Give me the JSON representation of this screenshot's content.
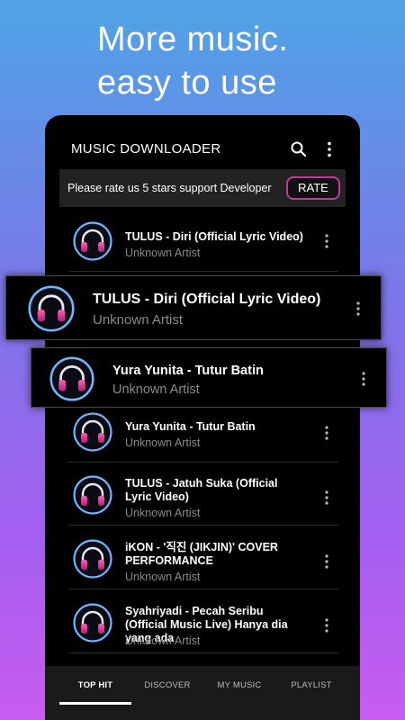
{
  "promo": {
    "line1": "More music.",
    "line2": "easy to use"
  },
  "app": {
    "title": "MUSIC DOWNLOADER",
    "search_icon": "search-icon",
    "menu_icon": "more-vert-icon"
  },
  "rate_banner": {
    "text": "Please rate us 5 stars support Developer",
    "button_label": "RATE"
  },
  "songs": [
    {
      "title": "TULUS - Diri (Official Lyric Video)",
      "artist": "Unknown Artist"
    },
    {
      "title": "Yura Yunita - Tutur Batin",
      "artist": "Unknown Artist"
    },
    {
      "title": "TULUS - Jatuh Suka (Official Lyric Video)",
      "artist": "Unknown Artist"
    },
    {
      "title": "iKON - '직진 (JIKJIN)' COVER PERFORMANCE",
      "artist": "Unknown Artist"
    },
    {
      "title": "Syahriyadi - Pecah Seribu (Official Music Live) Hanya dia yang ada",
      "artist": "Unknown Artist"
    }
  ],
  "popups": [
    {
      "title": "TULUS - Diri (Official Lyric Video)",
      "artist": "Unknown Artist"
    },
    {
      "title": "Yura Yunita - Tutur Batin",
      "artist": "Unknown Artist"
    }
  ],
  "bottom_nav": {
    "tabs": [
      "TOP HIT",
      "DISCOVER",
      "MY MUSIC",
      "PLAYLIST"
    ],
    "active": "TOP HIT"
  },
  "colors": {
    "accent": "#c13aa0",
    "icon_ring": "#6fb7ff",
    "icon_pink": "#e040a0"
  }
}
